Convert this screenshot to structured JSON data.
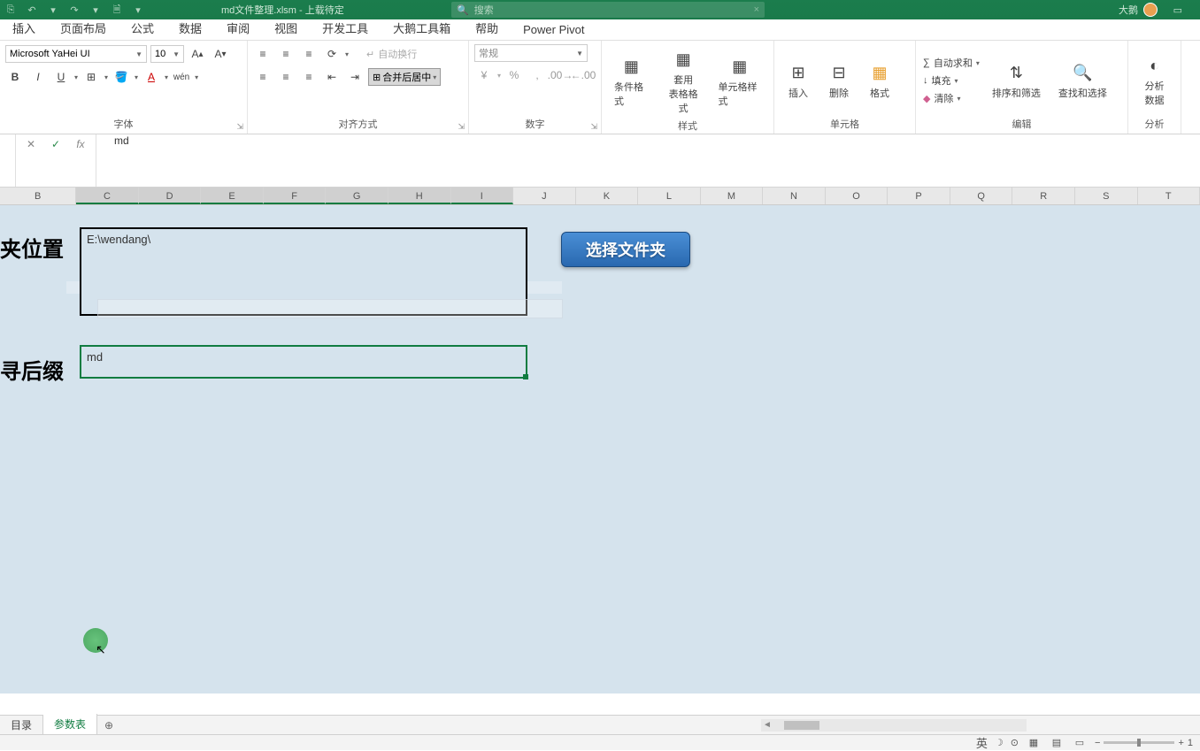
{
  "titlebar": {
    "filename": "md文件整理.xlsm",
    "status": "上载待定",
    "search_placeholder": "搜索",
    "username": "大鹅"
  },
  "tabs": [
    "插入",
    "页面布局",
    "公式",
    "数据",
    "审阅",
    "视图",
    "开发工具",
    "大鹅工具箱",
    "帮助",
    "Power Pivot"
  ],
  "ribbon": {
    "font": {
      "name": "Microsoft YaHei UI",
      "size": "10",
      "label": "字体"
    },
    "alignment": {
      "wrap": "自动换行",
      "merge": "合并后居中",
      "label": "对齐方式"
    },
    "number": {
      "format": "常规",
      "label": "数字"
    },
    "styles": {
      "cond": "条件格式",
      "table": "套用\n表格格式",
      "cell": "单元格样式",
      "label": "样式"
    },
    "cells": {
      "insert": "插入",
      "delete": "删除",
      "format": "格式",
      "label": "单元格"
    },
    "editing": {
      "autosum": "自动求和",
      "fill": "填充",
      "clear": "清除",
      "sort": "排序和筛选",
      "find": "查找和选择",
      "label": "编辑"
    },
    "analysis": {
      "analyze": "分析\n数据",
      "label": "分析"
    }
  },
  "formula_bar": {
    "value": "md"
  },
  "columns": [
    "B",
    "C",
    "D",
    "E",
    "F",
    "G",
    "H",
    "I",
    "J",
    "K",
    "L",
    "M",
    "N",
    "O",
    "P",
    "Q",
    "R",
    "S",
    "T"
  ],
  "sheet": {
    "label_folder": "夹位置",
    "label_suffix": "寻后缀",
    "folder_path": "E:\\wendang\\",
    "suffix_value": "md",
    "button_text": "选择文件夹"
  },
  "sheet_tabs": {
    "tab1": "目录",
    "tab2": "参数表"
  },
  "statusbar": {
    "ime": "英",
    "zoom": "1"
  }
}
